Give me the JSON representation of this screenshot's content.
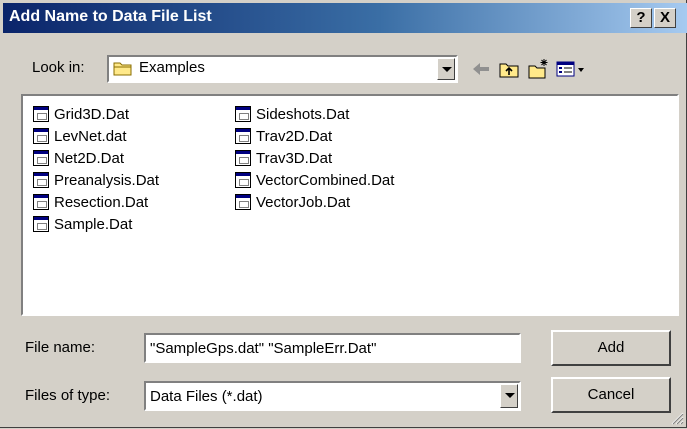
{
  "window": {
    "title": "Add Name to Data File List",
    "help_label": "?",
    "close_label": "X"
  },
  "look_in": {
    "label": "Look in:",
    "value": "Examples"
  },
  "toolbar": {
    "icons": [
      "back-arrow-icon",
      "up-folder-icon",
      "new-folder-icon",
      "view-menu-icon"
    ]
  },
  "files": {
    "col1": [
      "Grid3D.Dat",
      "LevNet.dat",
      "Net2D.Dat",
      "Preanalysis.Dat",
      "Resection.Dat",
      "Sample.Dat"
    ],
    "col2": [
      "Sideshots.Dat",
      "Trav2D.Dat",
      "Trav3D.Dat",
      "VectorCombined.Dat",
      "VectorJob.Dat"
    ]
  },
  "file_name": {
    "label": "File name:",
    "value": "\"SampleGps.dat\" \"SampleErr.Dat\""
  },
  "file_type": {
    "label": "Files of type:",
    "value": "Data Files (*.dat)"
  },
  "buttons": {
    "add": "Add",
    "cancel": "Cancel"
  },
  "colors": {
    "title_start": "#0a246a",
    "title_end": "#a6caf0",
    "face": "#d4d0c8"
  }
}
